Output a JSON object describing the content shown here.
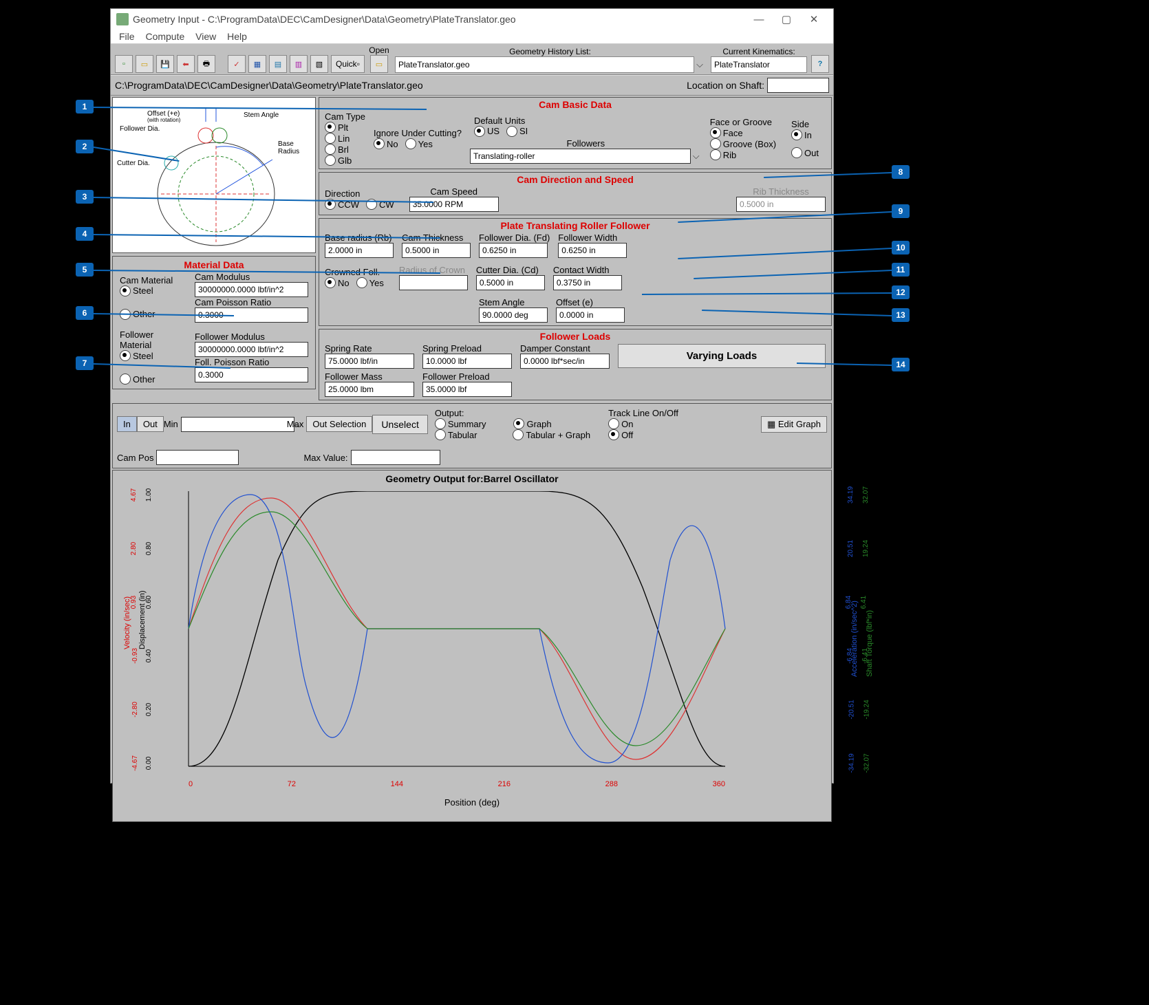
{
  "window": {
    "title": "Geometry Input - C:\\ProgramData\\DEC\\CamDesigner\\Data\\Geometry\\PlateTranslator.geo"
  },
  "menu": {
    "file": "File",
    "compute": "Compute",
    "view": "View",
    "help": "Help"
  },
  "toolbar": {
    "quick": "Quick",
    "open_label": "Open",
    "history_label": "Geometry History List:",
    "history_value": "PlateTranslator.geo",
    "kin_label": "Current Kinematics:",
    "kin_value": "PlateTranslator",
    "help_btn": "?"
  },
  "pathbar": {
    "path": "C:\\ProgramData\\DEC\\CamDesigner\\Data\\Geometry\\PlateTranslator.geo",
    "loc_label": "Location on Shaft:"
  },
  "diagram_labels": {
    "offset": "Offset (+e)",
    "offset2": "(with rotation)",
    "follower_dia": "Follower Dia.",
    "cutter_dia": "Cutter Dia.",
    "stem_angle": "Stem Angle",
    "base_radius": "Base\nRadius"
  },
  "cam_basic": {
    "title": "Cam Basic Data",
    "cam_type_label": "Cam Type",
    "cam_type_opts": {
      "plt": "Plt",
      "lin": "Lin",
      "brl": "Brl",
      "glb": "Glb"
    },
    "under_cutting_label": "Ignore Under Cutting?",
    "no": "No",
    "yes": "Yes",
    "default_units_label": "Default Units",
    "us": "US",
    "si": "SI",
    "followers_label": "Followers",
    "followers_value": "Translating-roller",
    "face_groove_label": "Face or Groove",
    "face": "Face",
    "groove": "Groove (Box)",
    "rib": "Rib",
    "side_label": "Side",
    "in": "In",
    "out": "Out"
  },
  "dir": {
    "title": "Cam Direction and Speed",
    "direction_label": "Direction",
    "ccw": "CCW",
    "cw": "CW",
    "speed_label": "Cam Speed",
    "speed_val": "35.0000 RPM",
    "rib_label": "Rib Thickness",
    "rib_val": "0.5000 in"
  },
  "plate": {
    "title": "Plate Translating Roller Follower",
    "base_radius_l": "Base radius (Rb)",
    "base_radius_v": "2.0000 in",
    "cam_thick_l": "Cam Thickness",
    "cam_thick_v": "0.5000 in",
    "foll_dia_l": "Follower Dia. (Fd)",
    "foll_dia_v": "0.6250 in",
    "foll_width_l": "Follower Width",
    "foll_width_v": "0.6250 in",
    "crowned_l": "Crowned Foll.",
    "radius_crown_l": "Radius of Crown",
    "radius_crown_v": "",
    "cutter_l": "Cutter Dia. (Cd)",
    "cutter_v": "0.5000 in",
    "contact_l": "Contact Width",
    "contact_v": "0.3750 in",
    "stem_l": "Stem Angle",
    "stem_v": "90.0000 deg",
    "offset_l": "Offset (e)",
    "offset_v": "0.0000 in"
  },
  "material": {
    "title": "Material Data",
    "cam_mat_l": "Cam Material",
    "steel": "Steel",
    "other": "Other",
    "cam_mod_l": "Cam Modulus",
    "cam_mod_v": "30000000.0000 lbf/in^2",
    "cam_poisson_l": "Cam Poisson Ratio",
    "cam_poisson_v": "0.3000",
    "foll_mat_l": "Follower Material",
    "foll_mod_l": "Follower Modulus",
    "foll_mod_v": "30000000.0000 lbf/in^2",
    "foll_poisson_l": "Foll. Poisson Ratio",
    "foll_poisson_v": "0.3000"
  },
  "loads": {
    "title": "Follower Loads",
    "spring_rate_l": "Spring Rate",
    "spring_rate_v": "75.0000 lbf/in",
    "spring_preload_l": "Spring Preload",
    "spring_preload_v": "10.0000 lbf",
    "damper_l": "Damper Constant",
    "damper_v": "0.0000 lbf*sec/in",
    "foll_mass_l": "Follower Mass",
    "foll_mass_v": "25.0000 lbm",
    "foll_preload_l": "Follower Preload",
    "foll_preload_v": "35.0000 lbf",
    "varying_btn": "Varying Loads"
  },
  "bottom": {
    "in": "In",
    "out": "Out",
    "min": "Min",
    "max": "Max",
    "out_sel": "Out Selection",
    "unsel": "Unselect",
    "campos_l": "Cam Pos",
    "maxval_l": "Max Value:",
    "output_l": "Output:",
    "summary": "Summary",
    "graph": "Graph",
    "tabular": "Tabular",
    "tabgraph": "Tabular + Graph",
    "track_l": "Track Line On/Off",
    "on": "On",
    "off": "Off",
    "edit_graph": "Edit Graph"
  },
  "graph": {
    "title": "Geometry Output for:Barrel Oscillator",
    "xlabel": "Position (deg)",
    "xticks": [
      "0",
      "72",
      "144",
      "216",
      "288",
      "360"
    ],
    "left_axes": [
      {
        "label": "Velocity (in/sec)",
        "color": "#d00",
        "ticks": [
          "-4.67",
          "-2.80",
          "-0.93",
          "0.93",
          "2.80",
          "4.67"
        ]
      },
      {
        "label": "Displacement (in)",
        "color": "#000",
        "ticks": [
          "0.00",
          "0.20",
          "0.40",
          "0.60",
          "0.80",
          "1.00"
        ]
      }
    ],
    "right_axes": [
      {
        "label": "Acceleration (in/sec^2)",
        "color": "#2050d0",
        "ticks": [
          "-34.19",
          "-20.51",
          "-6.84",
          "6.84",
          "20.51",
          "34.19"
        ]
      },
      {
        "label": "Shaft Torque (lbf*in)",
        "color": "#2a8a2a",
        "ticks": [
          "-32.07",
          "-19.24",
          "-6.41",
          "6.41",
          "19.24",
          "32.07"
        ]
      }
    ]
  },
  "callouts": [
    "1",
    "2",
    "3",
    "4",
    "5",
    "6",
    "7",
    "8",
    "9",
    "10",
    "11",
    "12",
    "13",
    "14"
  ]
}
